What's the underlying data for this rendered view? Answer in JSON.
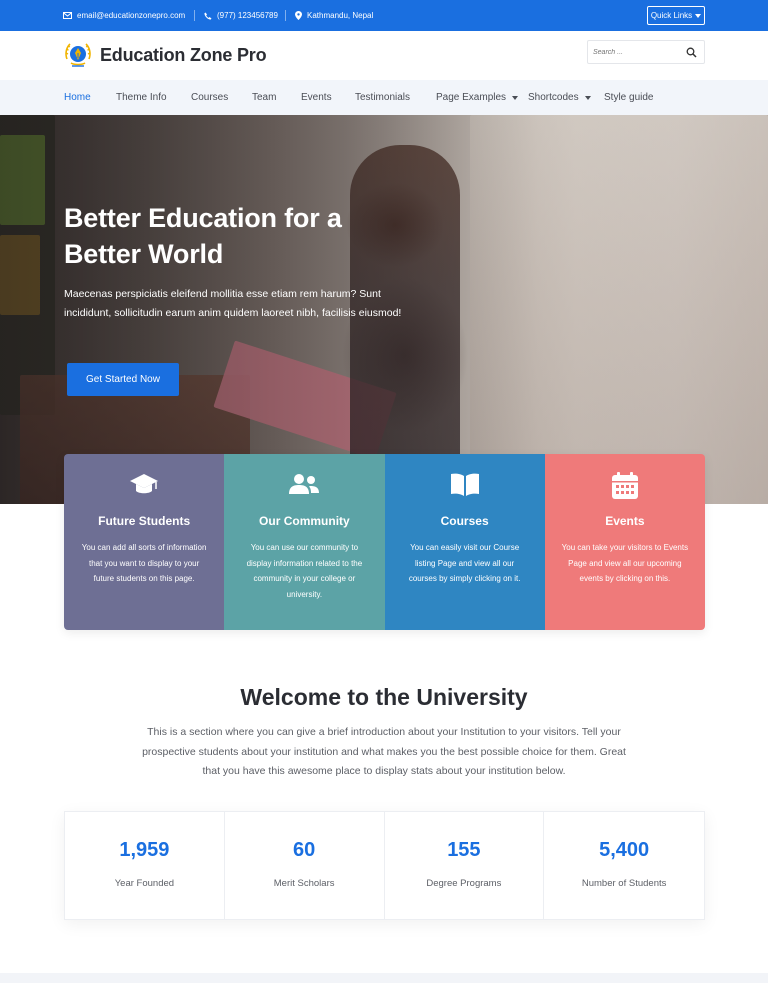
{
  "topbar": {
    "email": "email@educationzonepro.com",
    "phone": "(977) 123456789",
    "location": "Kathmandu, Nepal",
    "quick_links": "Quick Links"
  },
  "header": {
    "brand": "Education Zone Pro",
    "search_placeholder": "Search ..."
  },
  "nav": {
    "items": [
      {
        "label": "Home"
      },
      {
        "label": "Theme Info"
      },
      {
        "label": "Courses"
      },
      {
        "label": "Team"
      },
      {
        "label": "Events"
      },
      {
        "label": "Testimonials"
      },
      {
        "label": "Page Examples"
      },
      {
        "label": "Shortcodes"
      },
      {
        "label": "Style guide"
      }
    ]
  },
  "hero": {
    "title": "Better Education for a Better World",
    "text": "Maecenas perspiciatis eleifend mollitia esse etiam rem harum? Sunt incididunt, sollicitudin earum anim quidem laoreet nibh, facilisis eiusmod!",
    "cta": "Get Started Now"
  },
  "cards": [
    {
      "title": "Future Students",
      "text": "You can add all sorts of information that you want to display to your future students on this page.",
      "color": "#6e6f94",
      "icon": "graduation-cap-icon"
    },
    {
      "title": "Our Community",
      "text": "You can use our community to display information related to the community in your college or university.",
      "color": "#5ca3a6",
      "icon": "users-icon"
    },
    {
      "title": "Courses",
      "text": "You can easily visit our Course listing Page and view all our courses by simply clicking on it.",
      "color": "#2f86c2",
      "icon": "book-icon"
    },
    {
      "title": "Events",
      "text": "You can take your visitors to Events Page and view all our upcoming events by clicking on this.",
      "color": "#ef7a7a",
      "icon": "calendar-icon"
    }
  ],
  "welcome": {
    "title": "Welcome to the University",
    "text": "This is a section where you can give a brief introduction about your Institution to your visitors. Tell your prospective students about your institution and what makes you the best possible choice for them. Great that you have this awesome place to display stats about your institution below."
  },
  "stats": [
    {
      "value": "1,959",
      "label": "Year Founded"
    },
    {
      "value": "60",
      "label": "Merit Scholars"
    },
    {
      "value": "155",
      "label": "Degree Programs"
    },
    {
      "value": "5,400",
      "label": "Number of Students"
    }
  ],
  "colors": {
    "accent": "#1a6fe0",
    "nav_bg": "#f2f5fa"
  }
}
